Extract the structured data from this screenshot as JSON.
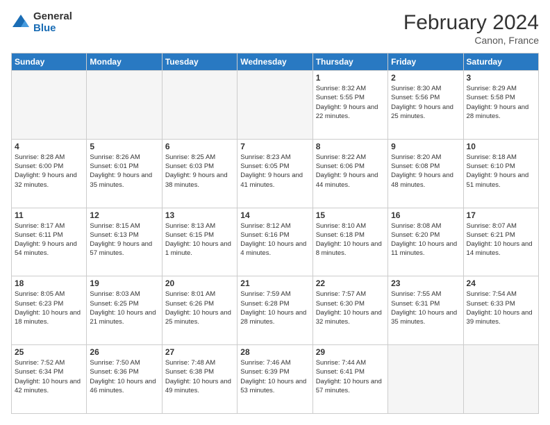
{
  "logo": {
    "general": "General",
    "blue": "Blue"
  },
  "title": "February 2024",
  "location": "Canon, France",
  "headers": [
    "Sunday",
    "Monday",
    "Tuesday",
    "Wednesday",
    "Thursday",
    "Friday",
    "Saturday"
  ],
  "weeks": [
    [
      {
        "day": "",
        "info": ""
      },
      {
        "day": "",
        "info": ""
      },
      {
        "day": "",
        "info": ""
      },
      {
        "day": "",
        "info": ""
      },
      {
        "day": "1",
        "info": "Sunrise: 8:32 AM\nSunset: 5:55 PM\nDaylight: 9 hours and 22 minutes."
      },
      {
        "day": "2",
        "info": "Sunrise: 8:30 AM\nSunset: 5:56 PM\nDaylight: 9 hours and 25 minutes."
      },
      {
        "day": "3",
        "info": "Sunrise: 8:29 AM\nSunset: 5:58 PM\nDaylight: 9 hours and 28 minutes."
      }
    ],
    [
      {
        "day": "4",
        "info": "Sunrise: 8:28 AM\nSunset: 6:00 PM\nDaylight: 9 hours and 32 minutes."
      },
      {
        "day": "5",
        "info": "Sunrise: 8:26 AM\nSunset: 6:01 PM\nDaylight: 9 hours and 35 minutes."
      },
      {
        "day": "6",
        "info": "Sunrise: 8:25 AM\nSunset: 6:03 PM\nDaylight: 9 hours and 38 minutes."
      },
      {
        "day": "7",
        "info": "Sunrise: 8:23 AM\nSunset: 6:05 PM\nDaylight: 9 hours and 41 minutes."
      },
      {
        "day": "8",
        "info": "Sunrise: 8:22 AM\nSunset: 6:06 PM\nDaylight: 9 hours and 44 minutes."
      },
      {
        "day": "9",
        "info": "Sunrise: 8:20 AM\nSunset: 6:08 PM\nDaylight: 9 hours and 48 minutes."
      },
      {
        "day": "10",
        "info": "Sunrise: 8:18 AM\nSunset: 6:10 PM\nDaylight: 9 hours and 51 minutes."
      }
    ],
    [
      {
        "day": "11",
        "info": "Sunrise: 8:17 AM\nSunset: 6:11 PM\nDaylight: 9 hours and 54 minutes."
      },
      {
        "day": "12",
        "info": "Sunrise: 8:15 AM\nSunset: 6:13 PM\nDaylight: 9 hours and 57 minutes."
      },
      {
        "day": "13",
        "info": "Sunrise: 8:13 AM\nSunset: 6:15 PM\nDaylight: 10 hours and 1 minute."
      },
      {
        "day": "14",
        "info": "Sunrise: 8:12 AM\nSunset: 6:16 PM\nDaylight: 10 hours and 4 minutes."
      },
      {
        "day": "15",
        "info": "Sunrise: 8:10 AM\nSunset: 6:18 PM\nDaylight: 10 hours and 8 minutes."
      },
      {
        "day": "16",
        "info": "Sunrise: 8:08 AM\nSunset: 6:20 PM\nDaylight: 10 hours and 11 minutes."
      },
      {
        "day": "17",
        "info": "Sunrise: 8:07 AM\nSunset: 6:21 PM\nDaylight: 10 hours and 14 minutes."
      }
    ],
    [
      {
        "day": "18",
        "info": "Sunrise: 8:05 AM\nSunset: 6:23 PM\nDaylight: 10 hours and 18 minutes."
      },
      {
        "day": "19",
        "info": "Sunrise: 8:03 AM\nSunset: 6:25 PM\nDaylight: 10 hours and 21 minutes."
      },
      {
        "day": "20",
        "info": "Sunrise: 8:01 AM\nSunset: 6:26 PM\nDaylight: 10 hours and 25 minutes."
      },
      {
        "day": "21",
        "info": "Sunrise: 7:59 AM\nSunset: 6:28 PM\nDaylight: 10 hours and 28 minutes."
      },
      {
        "day": "22",
        "info": "Sunrise: 7:57 AM\nSunset: 6:30 PM\nDaylight: 10 hours and 32 minutes."
      },
      {
        "day": "23",
        "info": "Sunrise: 7:55 AM\nSunset: 6:31 PM\nDaylight: 10 hours and 35 minutes."
      },
      {
        "day": "24",
        "info": "Sunrise: 7:54 AM\nSunset: 6:33 PM\nDaylight: 10 hours and 39 minutes."
      }
    ],
    [
      {
        "day": "25",
        "info": "Sunrise: 7:52 AM\nSunset: 6:34 PM\nDaylight: 10 hours and 42 minutes."
      },
      {
        "day": "26",
        "info": "Sunrise: 7:50 AM\nSunset: 6:36 PM\nDaylight: 10 hours and 46 minutes."
      },
      {
        "day": "27",
        "info": "Sunrise: 7:48 AM\nSunset: 6:38 PM\nDaylight: 10 hours and 49 minutes."
      },
      {
        "day": "28",
        "info": "Sunrise: 7:46 AM\nSunset: 6:39 PM\nDaylight: 10 hours and 53 minutes."
      },
      {
        "day": "29",
        "info": "Sunrise: 7:44 AM\nSunset: 6:41 PM\nDaylight: 10 hours and 57 minutes."
      },
      {
        "day": "",
        "info": ""
      },
      {
        "day": "",
        "info": ""
      }
    ]
  ]
}
